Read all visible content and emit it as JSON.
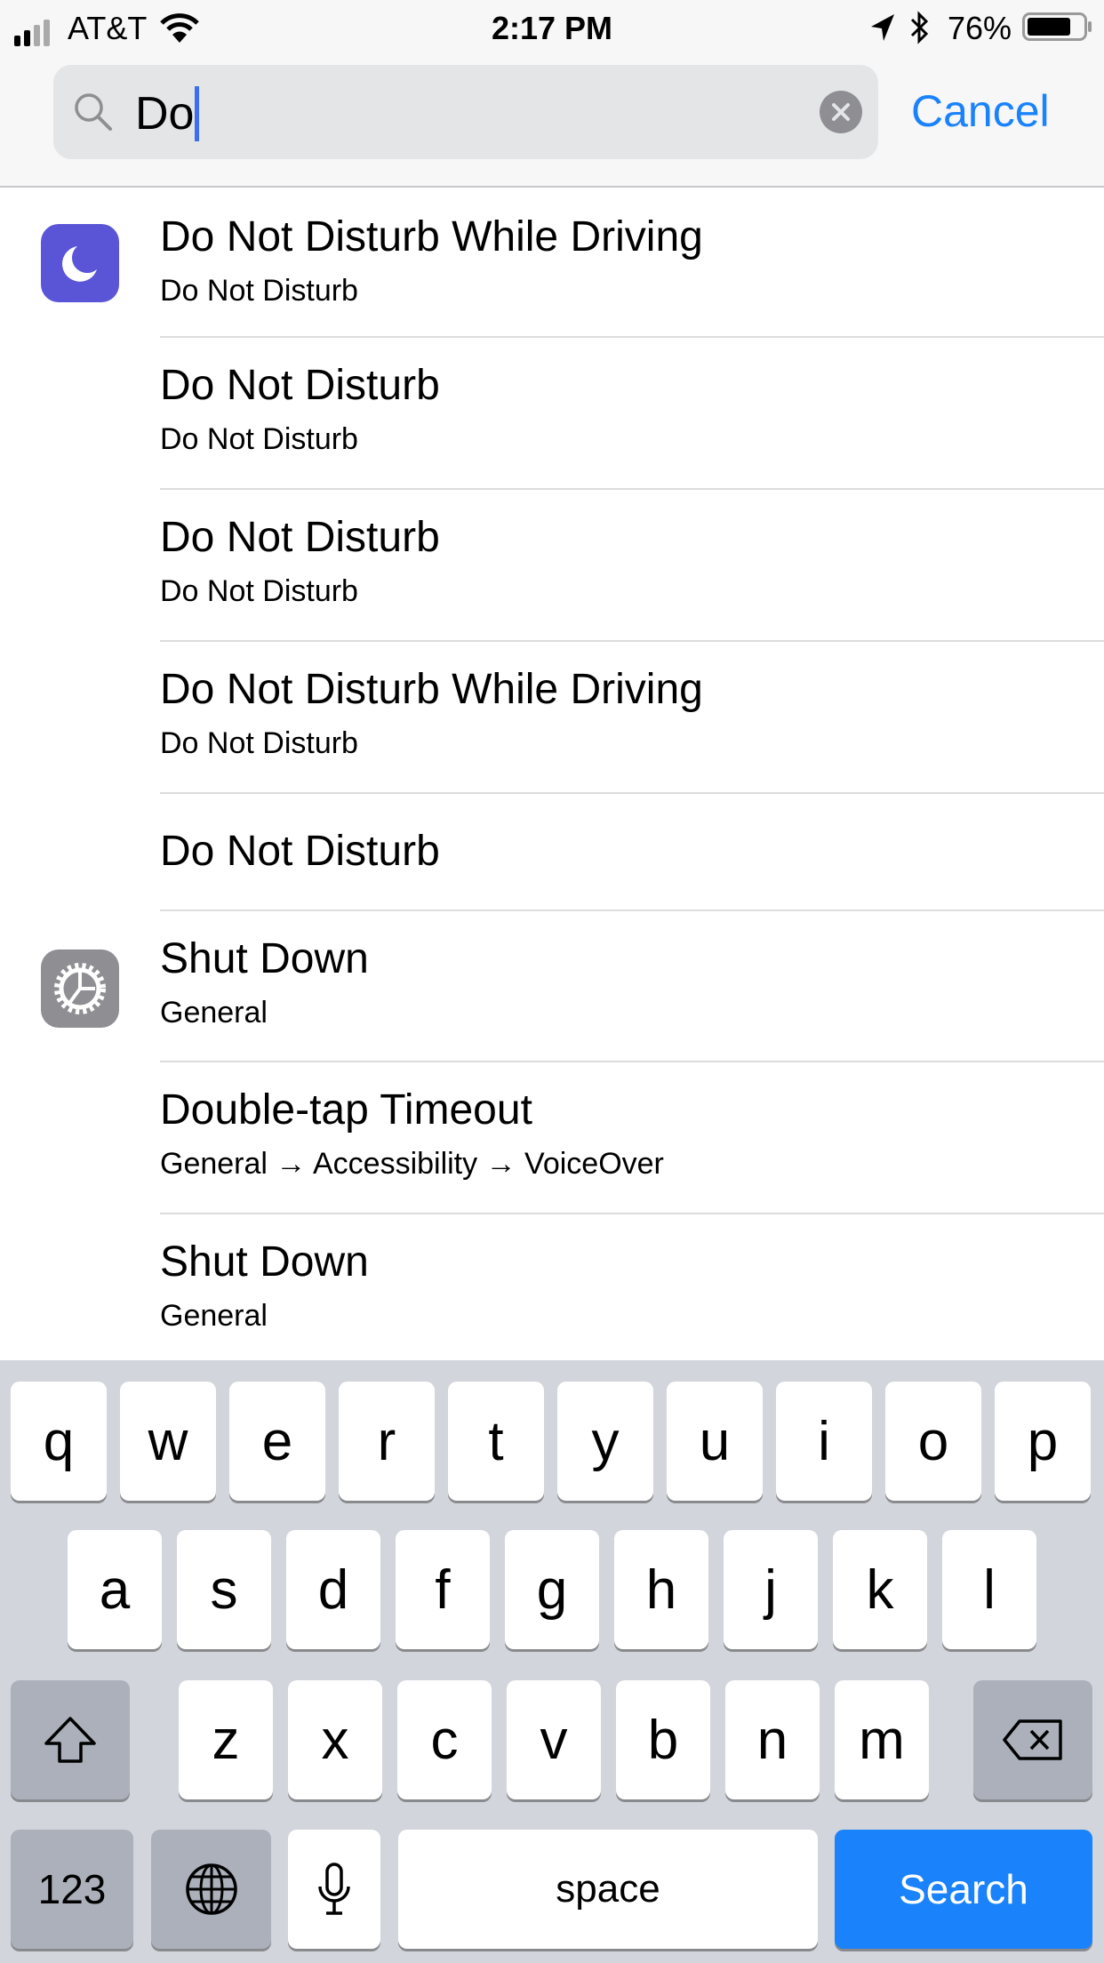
{
  "status_bar": {
    "carrier": "AT&T",
    "time": "2:17 PM",
    "battery": "76%",
    "battery_level": 0.76,
    "icons": [
      "signal-icon",
      "wifi-icon",
      "location-icon",
      "bluetooth-icon",
      "battery-icon"
    ]
  },
  "search": {
    "value": "Do",
    "cancel_label": "Cancel",
    "accent": "#1a82fb"
  },
  "results": [
    {
      "title": "Do Not Disturb While Driving",
      "subtitle": "Do Not Disturb",
      "icon": "moon-icon"
    },
    {
      "title": "Do Not Disturb",
      "subtitle": "Do Not Disturb"
    },
    {
      "title": "Do Not Disturb",
      "subtitle": "Do Not Disturb"
    },
    {
      "title": "Do Not Disturb While Driving",
      "subtitle": "Do Not Disturb"
    },
    {
      "title": "Do Not Disturb"
    },
    {
      "title": "Shut Down",
      "subtitle": "General",
      "icon": "gear-icon"
    },
    {
      "title": "Double-tap Timeout",
      "subtitle": "General → Accessibility → VoiceOver"
    },
    {
      "title": "Shut Down",
      "subtitle": "General"
    }
  ],
  "keyboard": {
    "row1": [
      "q",
      "w",
      "e",
      "r",
      "t",
      "y",
      "u",
      "i",
      "o",
      "p"
    ],
    "row2": [
      "a",
      "s",
      "d",
      "f",
      "g",
      "h",
      "j",
      "k",
      "l"
    ],
    "row3": [
      "z",
      "x",
      "c",
      "v",
      "b",
      "n",
      "m"
    ],
    "numbers_label": "123",
    "space_label": "space",
    "search_label": "Search"
  }
}
